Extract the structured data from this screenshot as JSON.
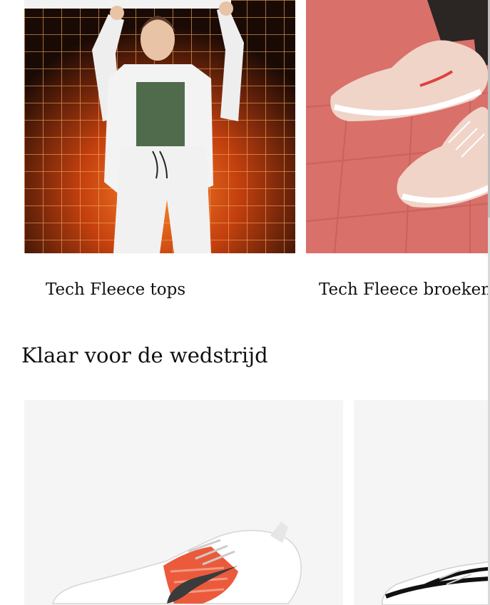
{
  "carousel": {
    "items": [
      {
        "label": "Tech Fleece tops",
        "image": "woman-in-white-tech-fleece-tracksuit"
      },
      {
        "label": "Tech Fleece broeken",
        "image": "pink-sneakers-on-red-tile-floor"
      }
    ]
  },
  "section": {
    "title": "Klaar voor de wedstrijd"
  },
  "products": [
    {
      "image": "white-running-shoe-with-red-pattern"
    },
    {
      "image": "white-running-shoe-with-black-swoosh"
    }
  ],
  "colors": {
    "background": "#ffffff",
    "text": "#111111",
    "card_background": "#f5f5f5"
  }
}
